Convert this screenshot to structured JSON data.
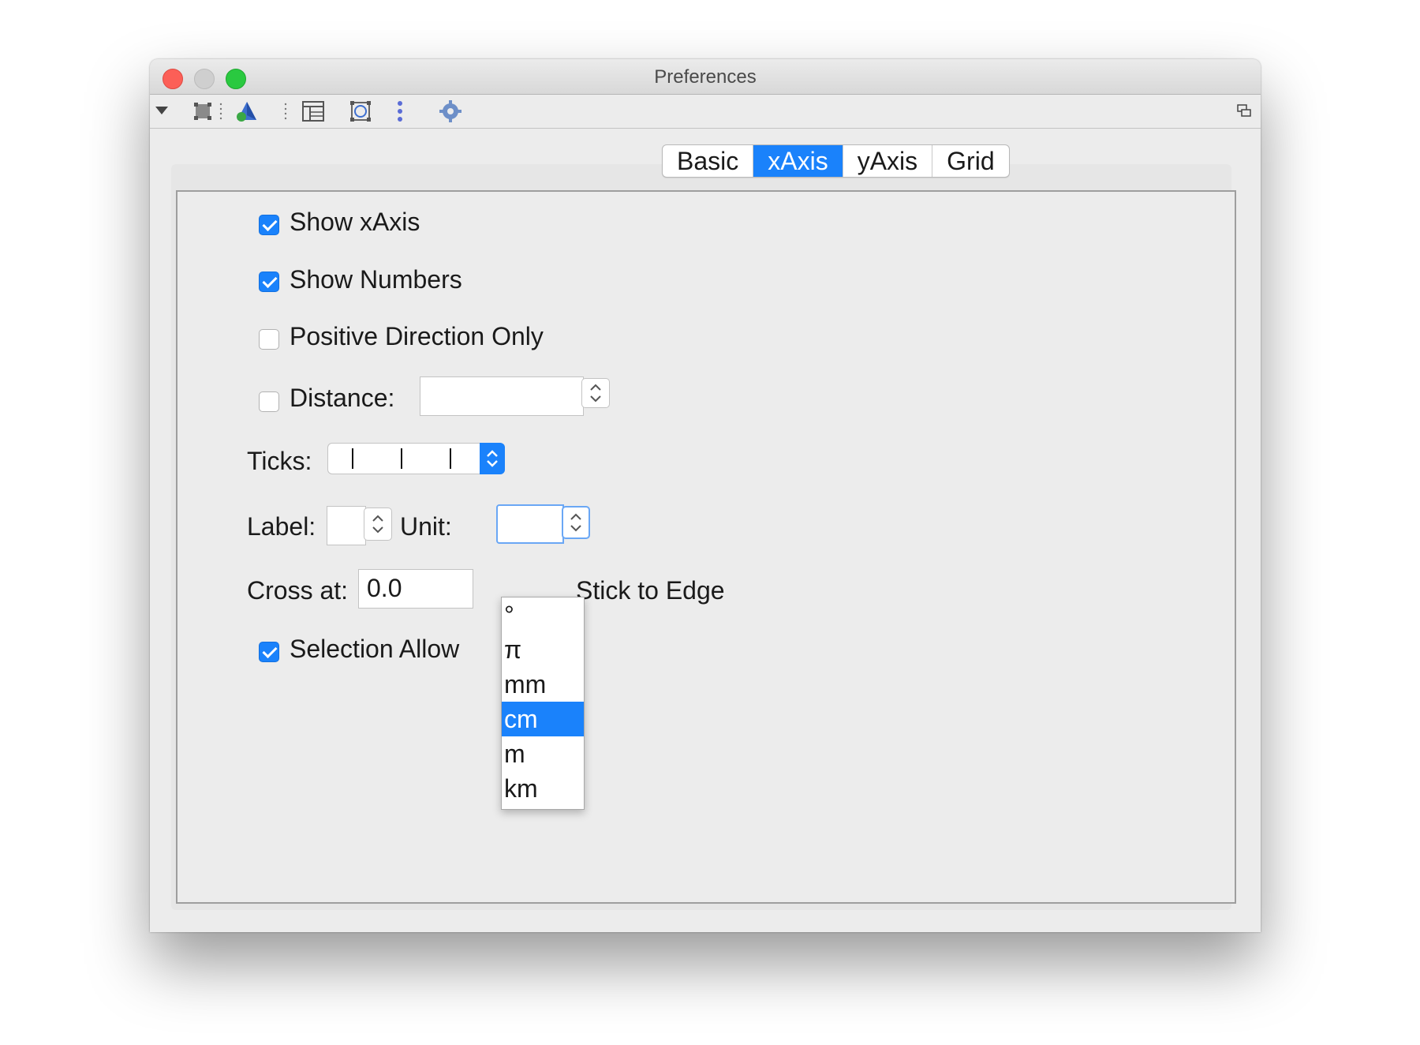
{
  "window": {
    "title": "Preferences"
  },
  "toolbar": {
    "icons": [
      "menu-triangle-icon",
      "graphics-view-icon",
      "graphics-3d-icon",
      "layout-icon",
      "algebra-icon",
      "separator-icon",
      "settings-gear-icon",
      "window-restore-icon"
    ]
  },
  "tabs": [
    {
      "label": "Basic",
      "active": false
    },
    {
      "label": "xAxis",
      "active": true
    },
    {
      "label": "yAxis",
      "active": false
    },
    {
      "label": "Grid",
      "active": false
    }
  ],
  "form": {
    "show_xaxis": {
      "label": "Show xAxis",
      "checked": true
    },
    "show_numbers": {
      "label": "Show Numbers",
      "checked": true
    },
    "positive_direction_only": {
      "label": "Positive Direction Only",
      "checked": false
    },
    "distance": {
      "label": "Distance:",
      "checked": false,
      "value": ""
    },
    "ticks": {
      "label": "Ticks:",
      "value": "| | |"
    },
    "label_field": {
      "label": "Label:",
      "value": ""
    },
    "unit": {
      "label": "Unit:",
      "value": ""
    },
    "cross_at": {
      "label": "Cross at:",
      "value": "0.0"
    },
    "stick_to_edge": {
      "label": "Stick to Edge"
    },
    "selection_allowed": {
      "label": "Selection Allow",
      "checked": true
    }
  },
  "unit_dropdown": {
    "options": [
      "°",
      "π",
      "mm",
      "cm",
      "m",
      "km"
    ],
    "selected": "cm"
  },
  "colors": {
    "accent": "#1a82fb",
    "window_bg": "#ececec"
  }
}
